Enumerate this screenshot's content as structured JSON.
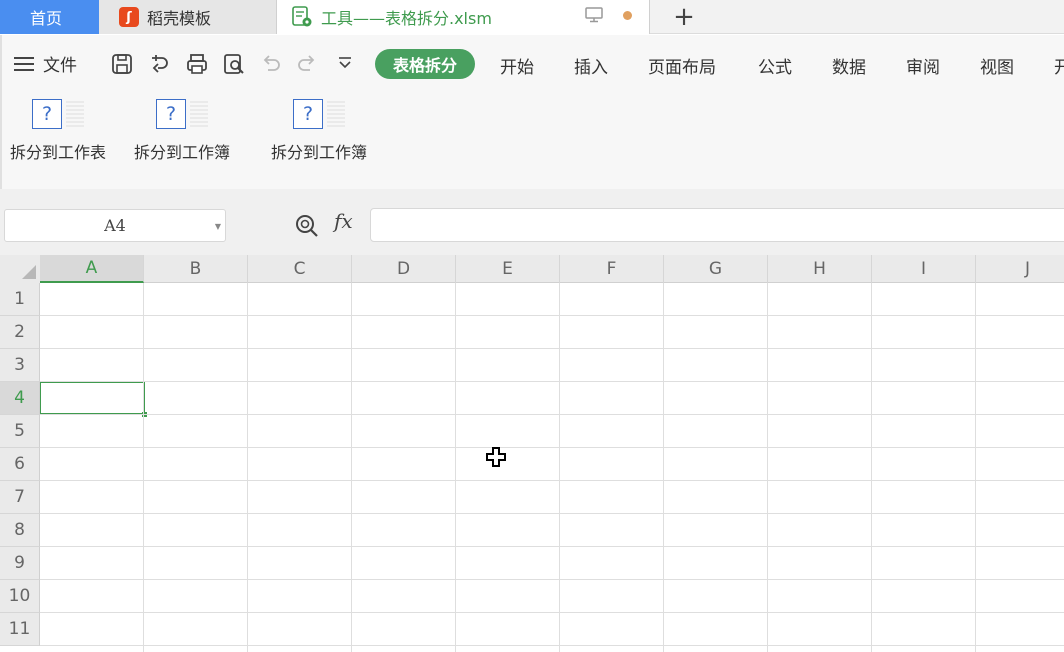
{
  "tabs": {
    "home": "首页",
    "template": "稻壳模板",
    "file": "工具——表格拆分.xlsm"
  },
  "menu": {
    "file": "文件",
    "active_tab": "表格拆分",
    "tabs": [
      "开始",
      "插入",
      "页面布局",
      "公式",
      "数据",
      "审阅",
      "视图",
      "开"
    ]
  },
  "tools": [
    {
      "label": "拆分到工作表"
    },
    {
      "label": "拆分到工作簿"
    },
    {
      "label": "拆分到工作簿"
    }
  ],
  "formula_bar": {
    "name_box": "A4",
    "fx": "fx",
    "formula": ""
  },
  "grid": {
    "columns": [
      "A",
      "B",
      "C",
      "D",
      "E",
      "F",
      "G",
      "H",
      "I",
      "J"
    ],
    "rows": [
      "1",
      "2",
      "3",
      "4",
      "5",
      "6",
      "7",
      "8",
      "9",
      "10",
      "11"
    ],
    "active_column": "A",
    "active_row": "4"
  },
  "colors": {
    "accent_green": "#49a060",
    "home_tab_blue": "#4a8ef0"
  }
}
